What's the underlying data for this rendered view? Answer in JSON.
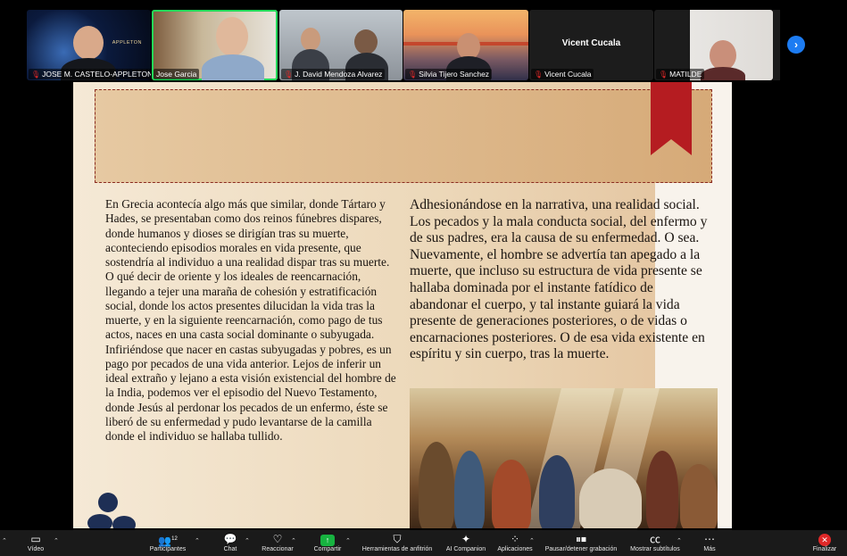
{
  "participants": [
    {
      "name": "JOSE M. CASTELO-APPLETON",
      "muted": true,
      "logo": "APPLETON"
    },
    {
      "name": "Jose Garcia",
      "muted": false,
      "active": true
    },
    {
      "name": "J. David Mendoza Alvarez",
      "muted": true
    },
    {
      "name": "Silvia Tijero Sanchez",
      "muted": true
    },
    {
      "name": "Vicent Cucala",
      "muted": true,
      "display_label": "Vicent Cucala"
    },
    {
      "name": "MATILDE",
      "muted": true
    }
  ],
  "document": {
    "left_text": "En Grecia acontecía algo más que similar, donde Tártaro y Hades, se presentaban como dos reinos fúnebres dispares, donde humanos y dioses se dirigían tras su muerte, aconteciendo episodios morales en vida presente, que sostendría al individuo a una realidad dispar tras su muerte. O qué decir de oriente y los ideales de reencarnación, llegando a tejer una maraña de cohesión y estratificación social, donde los actos presentes dilucidan la vida tras la muerte, y en la siguiente reencarnación, como pago de tus actos, naces en una casta social dominante o subyugada. Infiriéndose que nacer en castas subyugadas y pobres, es un pago por pecados de una vida anterior. Lejos de inferir un ideal extraño y lejano a esta visión existencial del hombre de la India, podemos ver el episodio del Nuevo Testamento, donde Jesús al perdonar los pecados de un enfermo, éste se  liberó de su enfermedad y pudo levantarse de la camilla donde el individuo se hallaba tullido.",
    "right_text": "Adhesionándose en la narrativa, una realidad social. Los pecados y la mala conducta social, del enfermo y de sus padres, era la causa de su enfermedad. O sea. Nuevamente, el hombre se advertía tan apegado a la muerte, que incluso su estructura de vida presente se hallaba dominada por el instante fatídico de abandonar el cuerpo, y tal instante guiará la vida presente de generaciones posteriores, o de vidas o encarnaciones posteriores. O de esa vida existente en espíritu y sin cuerpo, tras la muerte."
  },
  "toolbar": {
    "video": "Vídeo",
    "participants": "Participantes",
    "participants_count": "12",
    "chat": "Chat",
    "reactions": "Reaccionar",
    "share": "Compartir",
    "host_tools": "Herramientas de anfitrión",
    "ai_companion": "AI Companion",
    "apps": "Aplicaciones",
    "recording": "Pausar/detener grabación",
    "captions": "Mostrar subtítulos",
    "more": "Más",
    "end": "Finalizar"
  },
  "colors": {
    "accent_green": "#23d959",
    "share_green": "#17b340",
    "end_red": "#e02828",
    "nav_blue": "#1d7cf2",
    "ribbon_red": "#b51c21"
  }
}
